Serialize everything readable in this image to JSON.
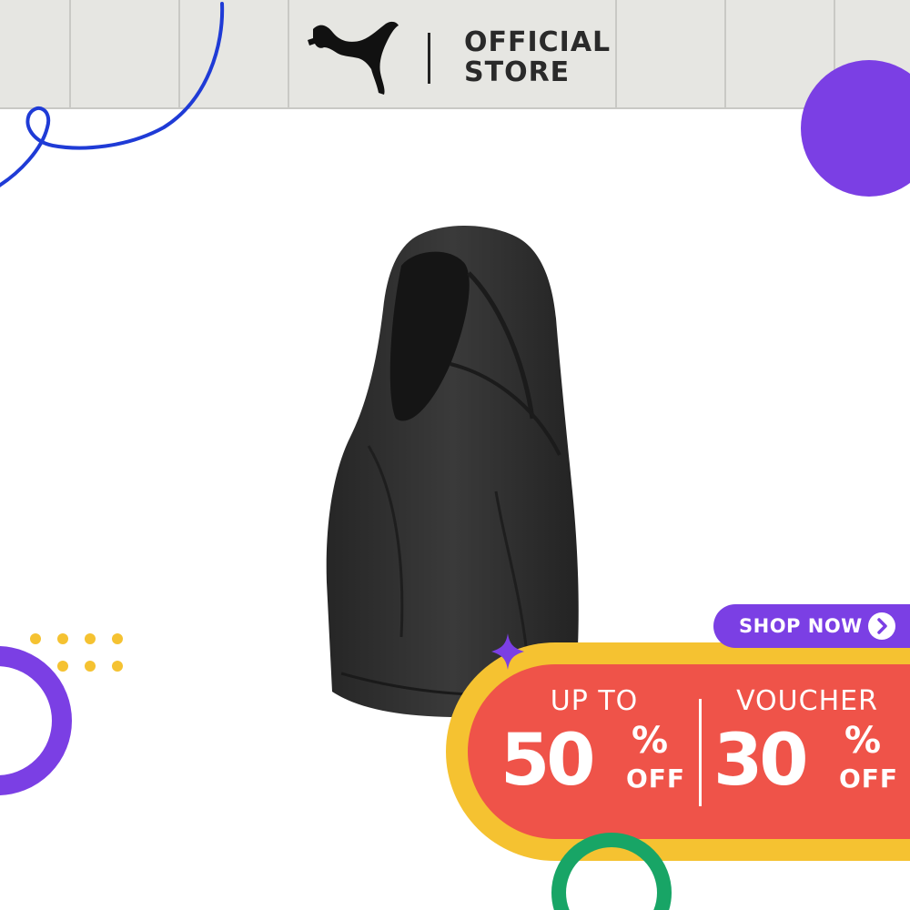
{
  "header": {
    "brand_icon": "puma-cat-logo-icon",
    "store_line1": "OFFICIAL",
    "store_line2": "STORE"
  },
  "product": {
    "image": "black-hijab-product-image"
  },
  "promo": {
    "discount_label": "UP TO",
    "discount_value": "50",
    "discount_percent": "%",
    "discount_off": "OFF",
    "voucher_label": "VOUCHER",
    "voucher_value": "30",
    "voucher_percent": "%",
    "voucher_off": "OFF",
    "cta_label": "SHOP NOW",
    "cta_icon": "chevron-right-icon"
  },
  "colors": {
    "header_bg": "#e6e6e2",
    "accent_purple": "#7b3fe4",
    "accent_yellow": "#f5c231",
    "promo_red": "#ef5349",
    "accent_green": "#18a566",
    "squiggle_blue": "#1f3bd6"
  }
}
